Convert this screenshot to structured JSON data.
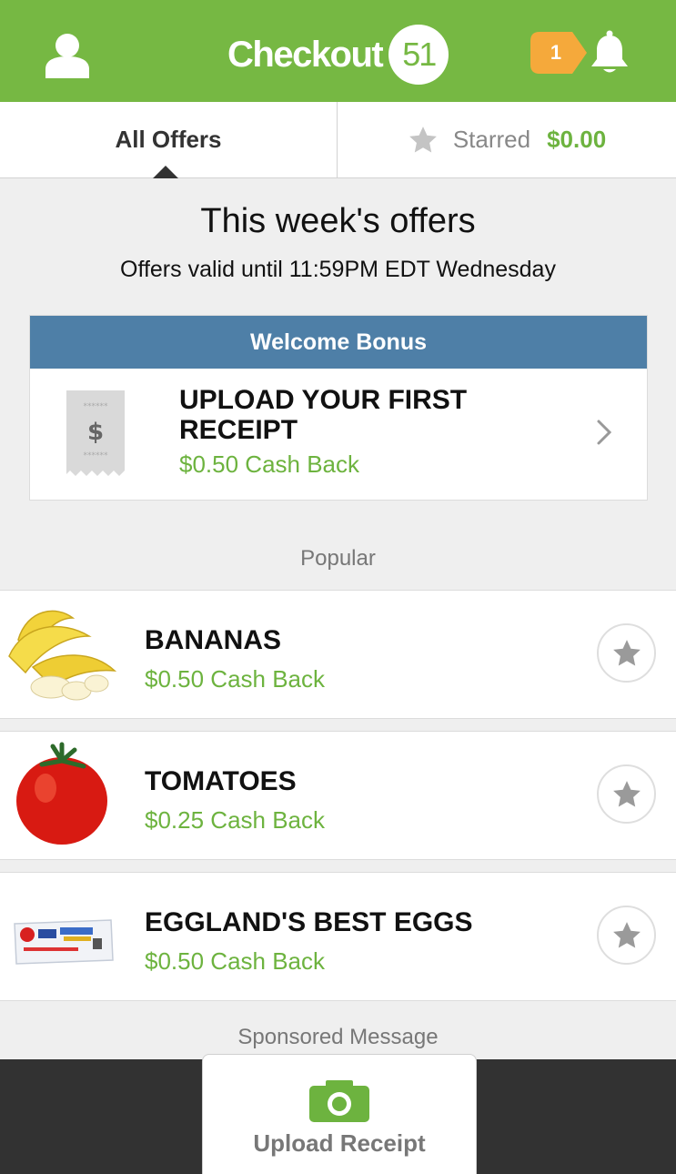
{
  "header": {
    "logo_text": "Checkout",
    "logo_number": "51",
    "notification_count": "1",
    "background_color": "#76b843"
  },
  "tabs": {
    "all_offers": "All Offers",
    "starred": "Starred",
    "starred_amount": "$0.00"
  },
  "offers_section": {
    "title": "This week's offers",
    "subtitle": "Offers valid until 11:59PM EDT Wednesday"
  },
  "welcome_bonus": {
    "header": "Welcome Bonus",
    "title": "UPLOAD YOUR FIRST RECEIPT",
    "cash_back": "$0.50 Cash Back",
    "header_color": "#4e7fa7"
  },
  "popular_label": "Popular",
  "offers": [
    {
      "title": "BANANAS",
      "cash_back": "$0.50 Cash Back",
      "image_icon": "banana-icon"
    },
    {
      "title": "TOMATOES",
      "cash_back": "$0.25 Cash Back",
      "image_icon": "tomato-icon"
    },
    {
      "title": "EGGLAND'S BEST EGGS",
      "cash_back": "$0.50 Cash Back",
      "image_icon": "egg-carton-icon"
    }
  ],
  "sponsored_label": "Sponsored Message",
  "bottom": {
    "upload_label": "Upload Receipt"
  },
  "colors": {
    "accent_green": "#6db33f",
    "badge_orange": "#f5a93b"
  }
}
